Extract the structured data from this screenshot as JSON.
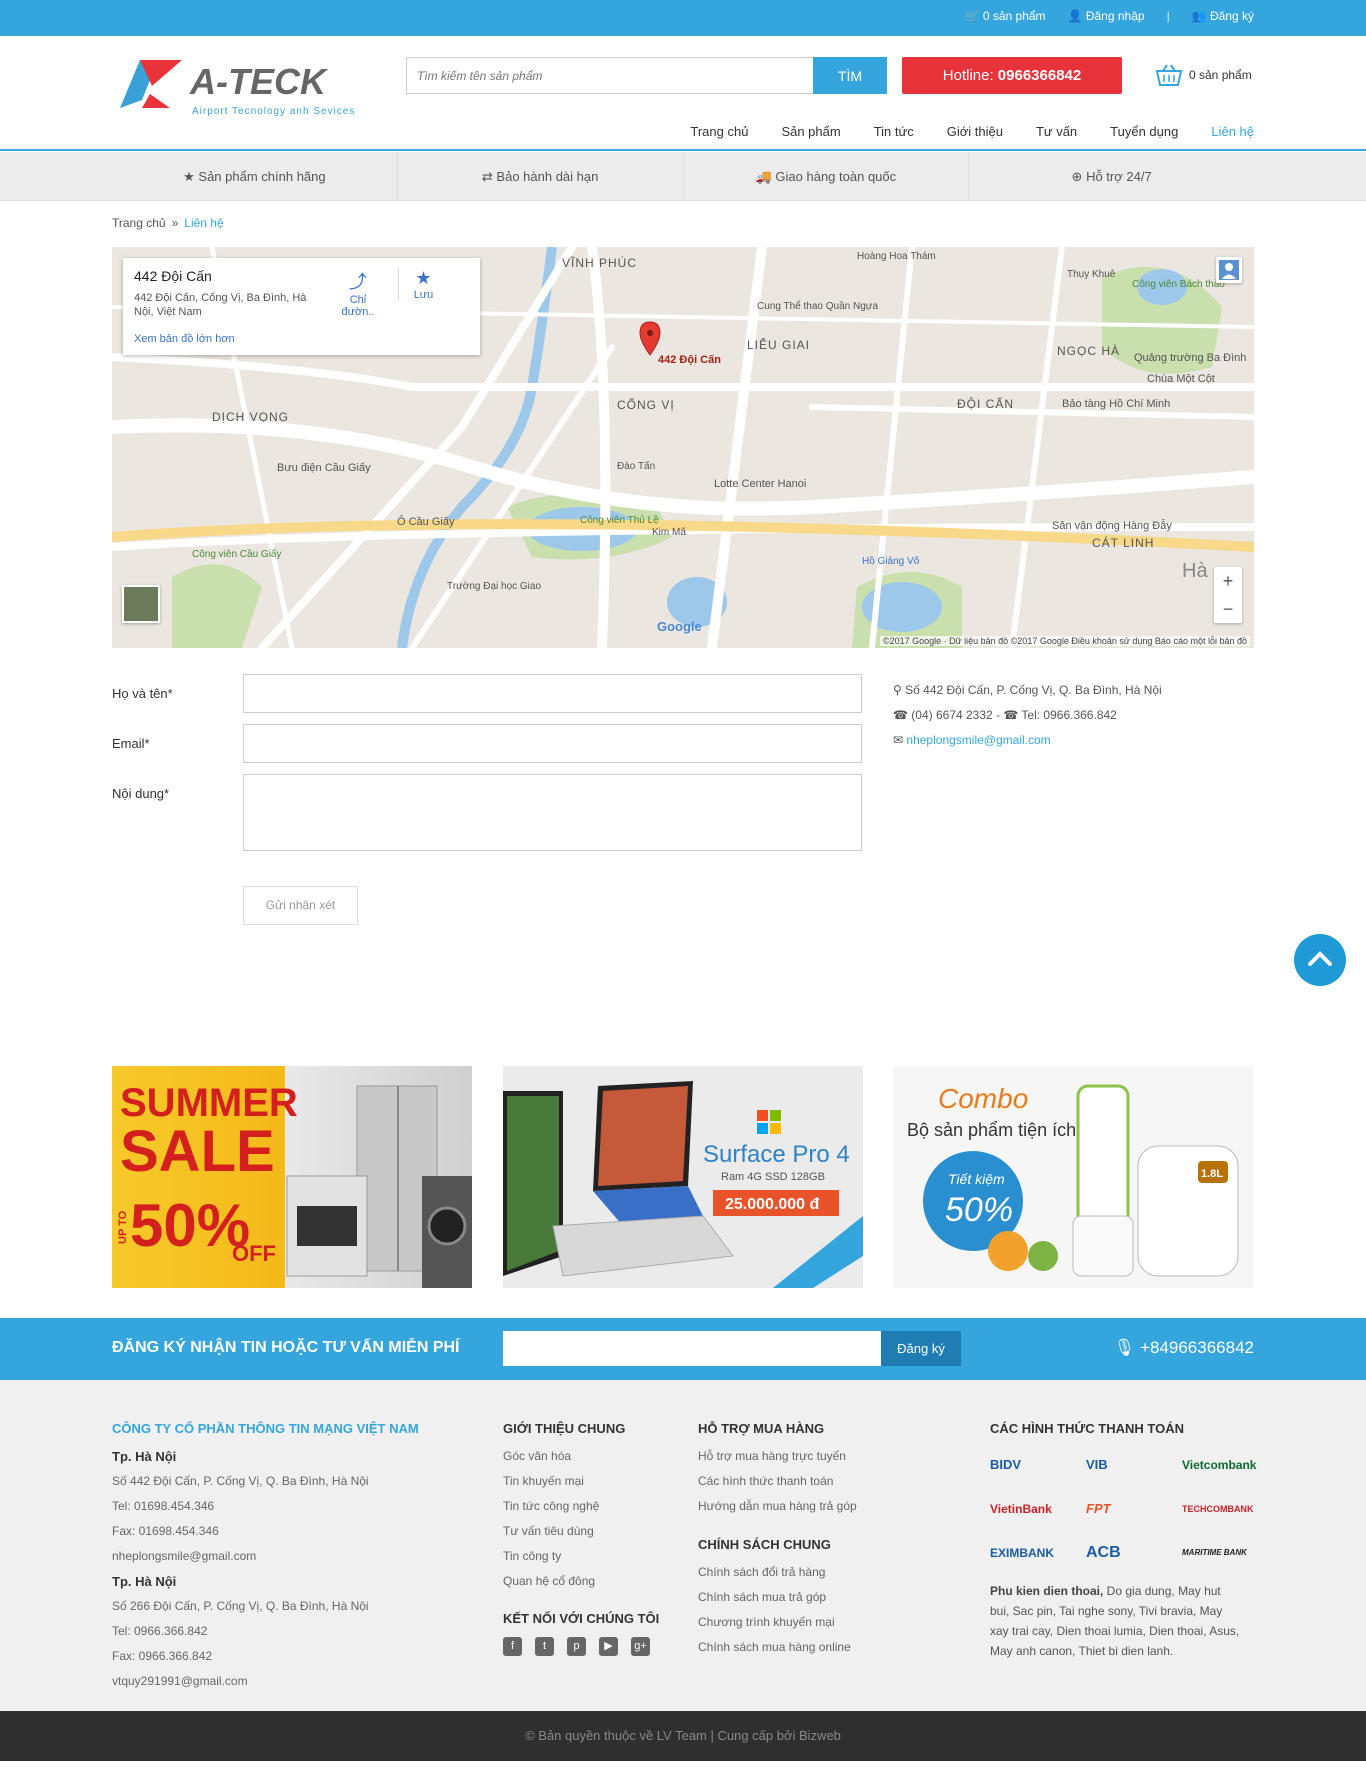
{
  "topbar": {
    "cart": "0 sản phẩm",
    "login": "Đăng nhập",
    "sep": "|",
    "register": "Đăng ký"
  },
  "header": {
    "logo_text": "A-TECK",
    "logo_tagline": "Airport Tecnology anh Sevices",
    "search_placeholder": "Tìm kiếm tên sản phẩm",
    "search_button": "TÌM",
    "hotline_label": "Hotline:",
    "hotline_number": "0966366842",
    "cart_count": "0 sản phẩm"
  },
  "nav": {
    "items": [
      "Trang chủ",
      "Sản phẩm",
      "Tin tức",
      "Giới thiệu",
      "Tư vấn",
      "Tuyển dụng",
      "Liên hệ"
    ],
    "active": "Liên hệ"
  },
  "features": [
    "Sản phẩm chính hãng",
    "Bảo hành dài hạn",
    "Giao hàng toàn quốc",
    "Hỗ trợ 24/7"
  ],
  "breadcrumb": {
    "home": "Trang chủ",
    "current": "Liên hệ"
  },
  "map": {
    "place_title": "442 Đội Cấn",
    "place_address": "442 Đội Cấn, Cống Vị, Ba Đình, Hà Nội, Việt Nam",
    "directions": "Chỉ đườn..",
    "save": "Lưu",
    "larger_map": "Xem bản đồ lớn hơn",
    "pin_label": "442 Đội Cấn",
    "labels": {
      "l1": "VĨNH PHÚC",
      "l2": "LIỄU GIAI",
      "l3": "CỐNG VỊ",
      "l4": "ĐỘI CẤN",
      "l5": "NGỌC HÀ",
      "l6": "DỊCH VỌNG",
      "l7": "Lotte Center Hanoi",
      "l8": "Bưu điện Cầu Giấy",
      "l9": "Ô Cầu Giấy",
      "l10": "Sân vận động Hàng Đẫy",
      "l11": "CÁT LINH",
      "l12": "Công viên Thủ Lệ",
      "l13": "Cung Thể thao Quần Ngựa",
      "l14": "Bảo tàng Hồ Chí Minh",
      "l15": "Chùa Một Cột",
      "l16": "Quảng trường Ba Đình",
      "l17": "Hồ Giảng Võ",
      "l18": "Công viên Cầu Giấy",
      "l19": "Trường Đại học Giao",
      "l20": "Kim Mã",
      "l21": "Đào Tấn",
      "l22": "Công viên Bách thảo",
      "l23": "Thụy Khuê",
      "l24": "Hoàng Hoa Thám",
      "l25": "Hà"
    },
    "google": "Google",
    "copyright": "©2017 Google · Dữ liệu bản đồ ©2017 Google   Điều khoản sử dụng   Báo cáo một lỗi bản đồ",
    "zoom_in": "+",
    "zoom_out": "−"
  },
  "form": {
    "name_label": "Họ và tên*",
    "email_label": "Email*",
    "content_label": "Nội dung*",
    "submit": "Gửi nhận xét"
  },
  "contact": {
    "address": "Số 442 Đội Cấn, P. Cống Vị, Q. Ba Đình, Hà Nội",
    "phone": "(04) 6674 2332 - ☎ Tel: 0966.366.842",
    "email": "nheplongsmile@gmail.com"
  },
  "banners": {
    "b1": {
      "l1": "SUMMER",
      "l2": "SALE",
      "l3": "UP TO",
      "l4": "50%",
      "l5": "OFF"
    },
    "b2": {
      "title": "Surface Pro 4",
      "spec": "Ram 4G SSD 128GB",
      "price": "25.000.000 đ"
    },
    "b3": {
      "l1": "Combo",
      "l2": "Bộ sản phẩm tiện ích",
      "l3": "Tiết kiệm",
      "l4": "50%",
      "l5": "1.8L"
    }
  },
  "subscribe": {
    "label": "ĐĂNG KÝ NHẬN TIN HOẶC TƯ VẤN MIỄN PHÍ",
    "button": "Đăng ký",
    "phone": "+84966366842"
  },
  "footer": {
    "company": "CÔNG TY CỔ PHẦN THÔNG TIN MẠNG VIỆT NAM",
    "city1": "Tp. Hà Nội",
    "addr1": "Số 442 Đội Cấn, P. Cống Vị, Q. Ba Đình, Hà Nội",
    "tel1": "Tel: 01698.454.346",
    "fax1": "Fax: 01698.454.346",
    "mail1": "nheplongsmile@gmail.com",
    "city2": "Tp. Hà Nội",
    "addr2": "Số 266 Đội Cấn, P. Cống Vị, Q. Ba Đình, Hà Nội",
    "tel2": "Tel: 0966.366.842",
    "fax2": "Fax: 0966.366.842",
    "mail2": "vtquy291991@gmail.com",
    "intro_title": "GIỚI THIỆU CHUNG",
    "intro_links": [
      "Góc văn hóa",
      "Tin khuyến mại",
      "Tin tức công nghệ",
      "Tư vấn tiêu dùng",
      "Tin công ty",
      "Quan hệ cổ đông"
    ],
    "connect_title": "KẾT NỐI VỚI CHÚNG TÔI",
    "support_title": "HỖ TRỢ MUA HÀNG",
    "support_links": [
      "Hỗ trợ mua hàng trực tuyến",
      "Các hình thức thanh toán",
      "Hướng dẫn mua hàng trả góp"
    ],
    "policy_title": "CHÍNH SÁCH CHUNG",
    "policy_links": [
      "Chính sách đổi trả hàng",
      "Chính sách mua trả góp",
      "Chương trình khuyến mại",
      "Chính sách mua hàng online"
    ],
    "payment_title": "CÁC HÌNH THỨC THANH TOÁN",
    "banks": [
      "BIDV",
      "VIB",
      "Vietcombank",
      "VietinBank",
      "FPT",
      "TECHCOMBANK",
      "EXIMBANK",
      "ACB",
      "MARITIME BANK"
    ],
    "tags_bold": "Phu kien dien thoai,",
    "tags_rest": " Do gia dung, May hut bui, Sac pin, Tai nghe sony, Tivi bravia, May xay trai cay, Dien thoai lumia, Dien thoai, Asus, May anh canon, Thiet bi dien lanh."
  },
  "copyright": "© Bản quyền thuộc về LV Team | Cung cấp bởi Bizweb"
}
